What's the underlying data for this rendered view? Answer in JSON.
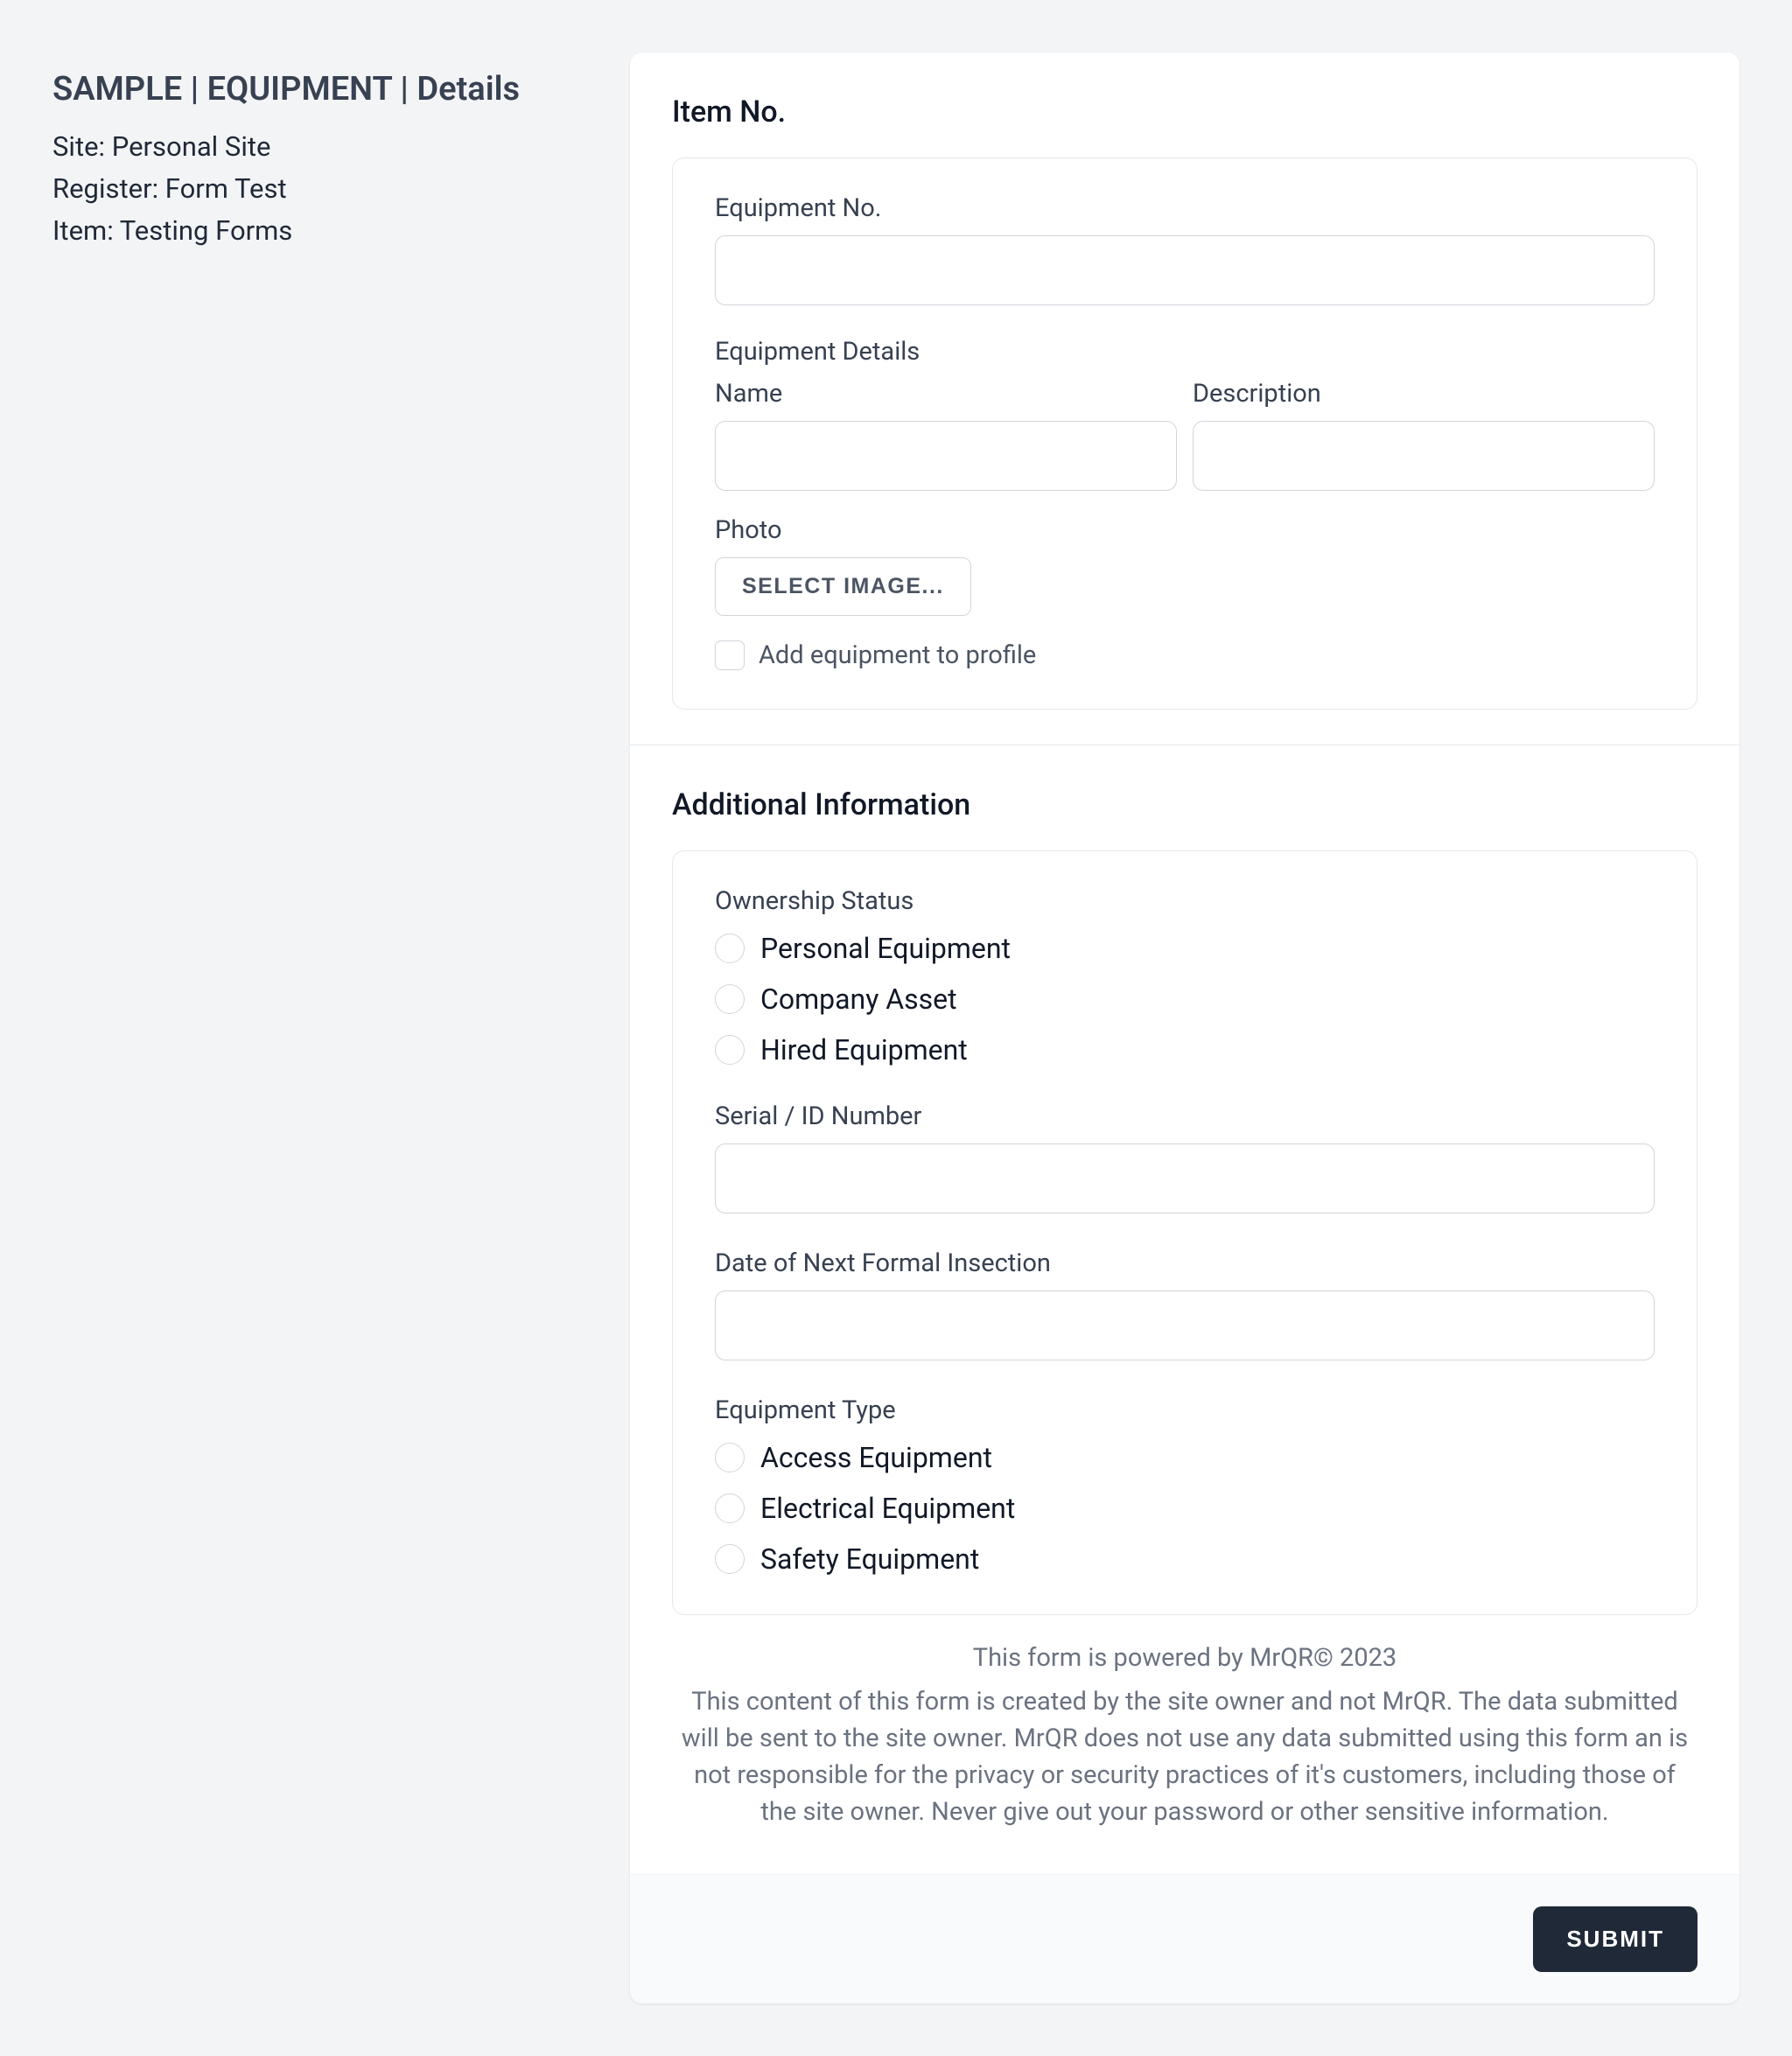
{
  "header": {
    "title": "SAMPLE | EQUIPMENT | Details",
    "site_label": "Site: Personal Site",
    "register_label": "Register: Form Test",
    "item_label": "Item: Testing Forms"
  },
  "section_item": {
    "title": "Item No.",
    "equipment_no_label": "Equipment No.",
    "equipment_no_value": "",
    "equipment_details_label": "Equipment Details",
    "name_label": "Name",
    "name_value": "",
    "description_label": "Description",
    "description_value": "",
    "photo_label": "Photo",
    "select_image_button": "SELECT IMAGE...",
    "add_to_profile_label": "Add equipment to profile"
  },
  "section_additional": {
    "title": "Additional Information",
    "ownership_status_label": "Ownership Status",
    "ownership_options": [
      "Personal Equipment",
      "Company Asset",
      "Hired Equipment"
    ],
    "serial_label": "Serial / ID Number",
    "serial_value": "",
    "inspection_label": "Date of Next Formal Insection",
    "inspection_value": "",
    "equipment_type_label": "Equipment Type",
    "equipment_type_options": [
      "Access Equipment",
      "Electrical Equipment",
      "Safety Equipment"
    ]
  },
  "powered_by": "This form is powered by MrQR© 2023",
  "disclaimer": "This content of this form is created by the site owner and not MrQR. The data submitted will be sent to the site owner. MrQR does not use any data submitted using this form an is not responsible for the privacy or security practices of it's customers, including those of the site owner. Never give out your password or other sensitive information.",
  "submit_button": "SUBMIT"
}
